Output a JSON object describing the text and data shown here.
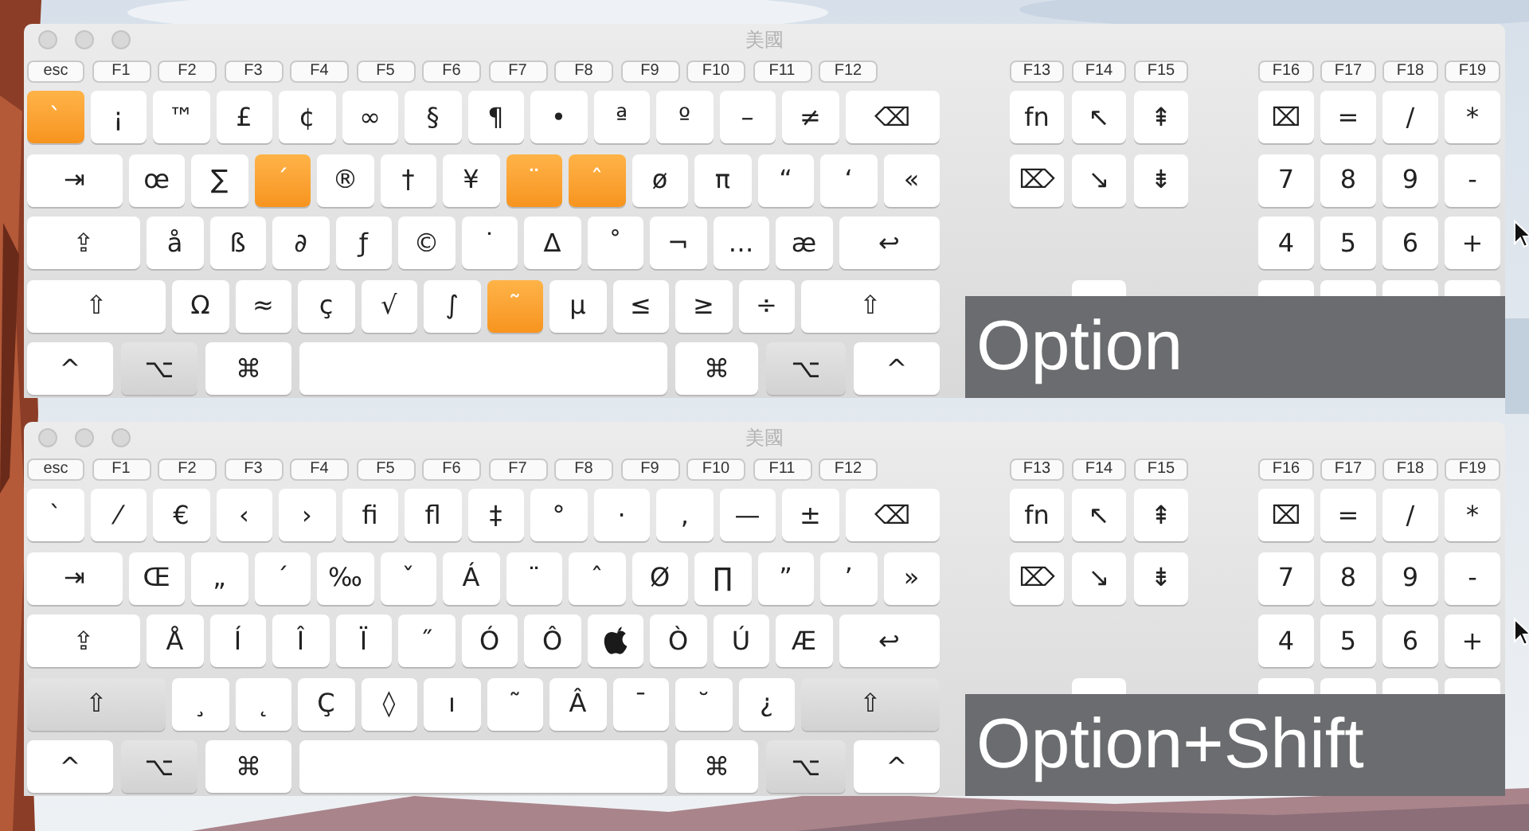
{
  "panels": [
    {
      "window": {
        "title": "美國"
      },
      "function_keys": [
        "esc",
        "F1",
        "F2",
        "F3",
        "F4",
        "F5",
        "F6",
        "F7",
        "F8",
        "F9",
        "F10",
        "F11",
        "F12"
      ],
      "main_rows": [
        [
          {
            "label": "`",
            "dead": true
          },
          {
            "label": "¡",
            "dead": false
          },
          {
            "label": "™",
            "dead": false
          },
          {
            "label": "£",
            "dead": false
          },
          {
            "label": "¢",
            "dead": false
          },
          {
            "label": "∞",
            "dead": false
          },
          {
            "label": "§",
            "dead": false
          },
          {
            "label": "¶",
            "dead": false
          },
          {
            "label": "•",
            "dead": false
          },
          {
            "label": "ª",
            "dead": false
          },
          {
            "label": "º",
            "dead": false
          },
          {
            "label": "–",
            "dead": false
          },
          {
            "label": "≠",
            "dead": false
          },
          {
            "label": "⌫",
            "dead": false
          }
        ],
        [
          {
            "label": "⇥",
            "dead": false
          },
          {
            "label": "œ",
            "dead": false
          },
          {
            "label": "∑",
            "dead": false
          },
          {
            "label": "´",
            "dead": true
          },
          {
            "label": "®",
            "dead": false
          },
          {
            "label": "†",
            "dead": false
          },
          {
            "label": "¥",
            "dead": false
          },
          {
            "label": "¨",
            "dead": true
          },
          {
            "label": "ˆ",
            "dead": true
          },
          {
            "label": "ø",
            "dead": false
          },
          {
            "label": "π",
            "dead": false
          },
          {
            "label": "“",
            "dead": false
          },
          {
            "label": "‘",
            "dead": false
          },
          {
            "label": "«",
            "dead": false
          }
        ],
        [
          {
            "kind": "char",
            "label": "⇪",
            "dead": false
          },
          {
            "kind": "char",
            "label": "å",
            "dead": false
          },
          {
            "kind": "char",
            "label": "ß",
            "dead": false
          },
          {
            "kind": "char",
            "label": "∂",
            "dead": false
          },
          {
            "kind": "char",
            "label": "ƒ",
            "dead": false
          },
          {
            "kind": "char",
            "label": "©",
            "dead": false
          },
          {
            "kind": "char",
            "label": "˙",
            "dead": false
          },
          {
            "kind": "char",
            "label": "∆",
            "dead": false
          },
          {
            "kind": "char",
            "label": "˚",
            "dead": false
          },
          {
            "kind": "char",
            "label": "¬",
            "dead": false
          },
          {
            "kind": "char",
            "label": "…",
            "dead": false
          },
          {
            "kind": "char",
            "label": "æ",
            "dead": false
          },
          {
            "kind": "char",
            "label": "↩",
            "dead": false
          }
        ],
        [
          {
            "label": "⇧",
            "dead": false,
            "pressed": false
          },
          {
            "label": "Ω",
            "dead": false,
            "pressed": false
          },
          {
            "label": "≈",
            "dead": false,
            "pressed": false
          },
          {
            "label": "ç",
            "dead": false,
            "pressed": false
          },
          {
            "label": "√",
            "dead": false,
            "pressed": false
          },
          {
            "label": "∫",
            "dead": false,
            "pressed": false
          },
          {
            "label": "˜",
            "dead": true,
            "pressed": false
          },
          {
            "label": "µ",
            "dead": false,
            "pressed": false
          },
          {
            "label": "≤",
            "dead": false,
            "pressed": false
          },
          {
            "label": "≥",
            "dead": false,
            "pressed": false
          },
          {
            "label": "÷",
            "dead": false,
            "pressed": false
          },
          {
            "label": "⇧",
            "dead": false,
            "pressed": false
          }
        ],
        [
          {
            "kind": "key",
            "label": "^",
            "pressed": false
          },
          {
            "kind": "key",
            "label": "⌥",
            "pressed": true
          },
          {
            "kind": "key",
            "label": "⌘",
            "pressed": false
          },
          {
            "kind": "space",
            "pressed": false
          },
          {
            "kind": "key",
            "label": "⌘",
            "pressed": false
          },
          {
            "kind": "key",
            "label": "⌥",
            "pressed": true
          },
          {
            "kind": "key",
            "label": "^",
            "pressed": false
          }
        ]
      ],
      "nav": {
        "function_keys": [
          "F13",
          "F14",
          "F15"
        ],
        "rows": [
          [
            "fn",
            "↖",
            "⇞"
          ],
          [
            "⌦",
            "↘",
            "⇟"
          ]
        ]
      },
      "keypad": {
        "function_keys": [
          "F16",
          "F17",
          "F18",
          "F19"
        ],
        "rows": [
          [
            "⌧",
            "=",
            "/",
            "*"
          ],
          [
            "7",
            "8",
            "9",
            "-"
          ],
          [
            "4",
            "5",
            "6",
            "+"
          ]
        ]
      },
      "caption": "Option"
    },
    {
      "window": {
        "title": "美國"
      },
      "function_keys": [
        "esc",
        "F1",
        "F2",
        "F3",
        "F4",
        "F5",
        "F6",
        "F7",
        "F8",
        "F9",
        "F10",
        "F11",
        "F12"
      ],
      "main_rows": [
        [
          {
            "label": "`",
            "dead": false
          },
          {
            "label": "⁄",
            "dead": false
          },
          {
            "label": "€",
            "dead": false
          },
          {
            "label": "‹",
            "dead": false
          },
          {
            "label": "›",
            "dead": false
          },
          {
            "label": "ﬁ",
            "dead": false
          },
          {
            "label": "ﬂ",
            "dead": false
          },
          {
            "label": "‡",
            "dead": false
          },
          {
            "label": "°",
            "dead": false
          },
          {
            "label": "·",
            "dead": false
          },
          {
            "label": "‚",
            "dead": false
          },
          {
            "label": "—",
            "dead": false
          },
          {
            "label": "±",
            "dead": false
          },
          {
            "label": "⌫",
            "dead": false
          }
        ],
        [
          {
            "label": "⇥",
            "dead": false
          },
          {
            "label": "Œ",
            "dead": false
          },
          {
            "label": "„",
            "dead": false
          },
          {
            "label": "´",
            "dead": false
          },
          {
            "label": "‰",
            "dead": false
          },
          {
            "label": "ˇ",
            "dead": false
          },
          {
            "label": "Á",
            "dead": false
          },
          {
            "label": "¨",
            "dead": false
          },
          {
            "label": "ˆ",
            "dead": false
          },
          {
            "label": "Ø",
            "dead": false
          },
          {
            "label": "∏",
            "dead": false
          },
          {
            "label": "”",
            "dead": false
          },
          {
            "label": "’",
            "dead": false
          },
          {
            "label": "»",
            "dead": false
          }
        ],
        [
          {
            "kind": "char",
            "label": "⇪",
            "dead": false
          },
          {
            "kind": "char",
            "label": "Å",
            "dead": false
          },
          {
            "kind": "char",
            "label": "Í",
            "dead": false
          },
          {
            "kind": "char",
            "label": "Î",
            "dead": false
          },
          {
            "kind": "char",
            "label": "Ï",
            "dead": false
          },
          {
            "kind": "char",
            "label": "˝",
            "dead": false
          },
          {
            "kind": "char",
            "label": "Ó",
            "dead": false
          },
          {
            "kind": "char",
            "label": "Ô",
            "dead": false
          },
          {
            "kind": "apple",
            "dead": false
          },
          {
            "kind": "char",
            "label": "Ò",
            "dead": false
          },
          {
            "kind": "char",
            "label": "Ú",
            "dead": false
          },
          {
            "kind": "char",
            "label": "Æ",
            "dead": false
          },
          {
            "kind": "char",
            "label": "↩",
            "dead": false
          }
        ],
        [
          {
            "label": "⇧",
            "dead": false,
            "pressed": true
          },
          {
            "label": "¸",
            "dead": false,
            "pressed": false
          },
          {
            "label": "˛",
            "dead": false,
            "pressed": false
          },
          {
            "label": "Ç",
            "dead": false,
            "pressed": false
          },
          {
            "label": "◊",
            "dead": false,
            "pressed": false
          },
          {
            "label": "ı",
            "dead": false,
            "pressed": false
          },
          {
            "label": "˜",
            "dead": false,
            "pressed": false
          },
          {
            "label": "Â",
            "dead": false,
            "pressed": false
          },
          {
            "label": "¯",
            "dead": false,
            "pressed": false
          },
          {
            "label": "˘",
            "dead": false,
            "pressed": false
          },
          {
            "label": "¿",
            "dead": false,
            "pressed": false
          },
          {
            "label": "⇧",
            "dead": false,
            "pressed": true
          }
        ],
        [
          {
            "kind": "key",
            "label": "^",
            "pressed": false
          },
          {
            "kind": "key",
            "label": "⌥",
            "pressed": true
          },
          {
            "kind": "key",
            "label": "⌘",
            "pressed": false
          },
          {
            "kind": "space",
            "pressed": false
          },
          {
            "kind": "key",
            "label": "⌘",
            "pressed": false
          },
          {
            "kind": "key",
            "label": "⌥",
            "pressed": true
          },
          {
            "kind": "key",
            "label": "^",
            "pressed": false
          }
        ]
      ],
      "nav": {
        "function_keys": [
          "F13",
          "F14",
          "F15"
        ],
        "rows": [
          [
            "fn",
            "↖",
            "⇞"
          ],
          [
            "⌦",
            "↘",
            "⇟"
          ]
        ]
      },
      "keypad": {
        "function_keys": [
          "F16",
          "F17",
          "F18",
          "F19"
        ],
        "rows": [
          [
            "⌧",
            "=",
            "/",
            "*"
          ],
          [
            "7",
            "8",
            "9",
            "-"
          ],
          [
            "4",
            "5",
            "6",
            "+"
          ]
        ]
      },
      "caption": "Option+Shift"
    }
  ]
}
